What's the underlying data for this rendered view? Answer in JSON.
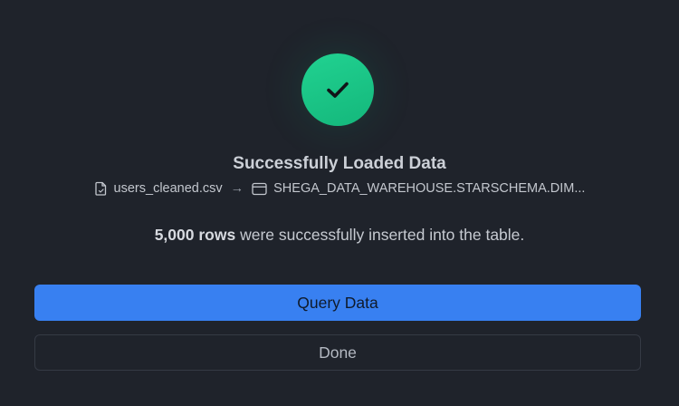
{
  "dialog": {
    "title": "Successfully Loaded Data",
    "source_file": "users_cleaned.csv",
    "arrow": "→",
    "destination_table": "SHEGA_DATA_WAREHOUSE.STARSCHEMA.DIM...",
    "rows_count": "5,000 rows",
    "message_suffix": "were successfully inserted into the table.",
    "primary_button_label": "Query Data",
    "secondary_button_label": "Done"
  },
  "colors": {
    "background": "#1f232b",
    "success": "#1ac98a",
    "primary": "#3880f1"
  },
  "icons": {
    "status": "check-icon",
    "source": "file-icon",
    "destination": "table-icon"
  }
}
